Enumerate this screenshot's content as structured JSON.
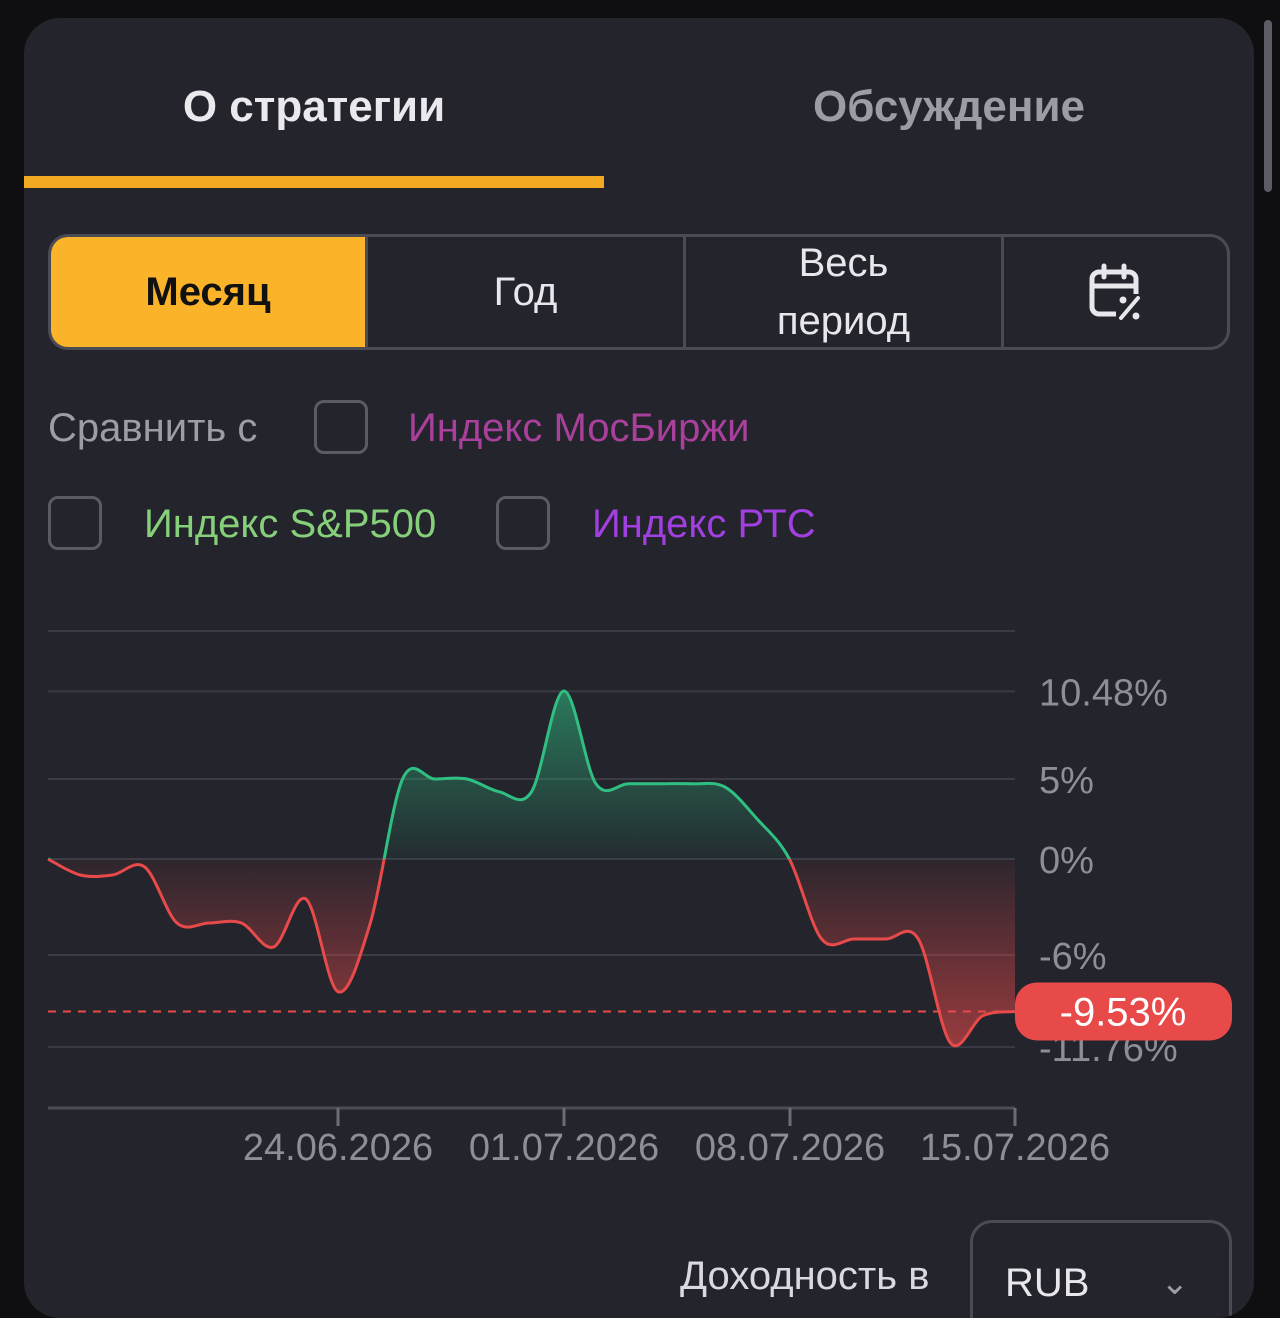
{
  "tabs": [
    {
      "label": "О стратегии",
      "active": true
    },
    {
      "label": "Обсуждение",
      "active": false
    }
  ],
  "period": {
    "options": [
      "Месяц",
      "Год",
      "Весь",
      "период"
    ],
    "selected": "Месяц",
    "calendar_icon": "calendar-percent-icon"
  },
  "compare": {
    "label": "Сравнить с",
    "indexes": [
      {
        "label": "Индекс МосБиржи",
        "color": "#a8409c",
        "checked": false
      },
      {
        "label": "Индекс S&P500",
        "color": "#86d07a",
        "checked": false
      },
      {
        "label": "Индекс РТС",
        "color": "#a23fe0",
        "checked": false
      }
    ]
  },
  "chart_data": {
    "type": "area",
    "y_tick_labels": [
      "10.48%",
      "5%",
      "0%",
      "-6%",
      "-11.76%"
    ],
    "y_ticks": [
      10.48,
      5,
      0,
      -6,
      -11.76
    ],
    "x_tick_labels": [
      "24.06.2026",
      "01.07.2026",
      "08.07.2026",
      "15.07.2026"
    ],
    "current_value_label": "-9.53%",
    "current_value": -9.53,
    "positive_color": "#2fbf82",
    "negative_color": "#e84a4a",
    "x_range": [
      "15.06.2026",
      "15.07.2026"
    ],
    "series": [
      {
        "x": [
          "15.06.2026",
          "16.06.2026",
          "17.06.2026",
          "18.06.2026",
          "19.06.2026",
          "20.06.2026",
          "21.06.2026",
          "22.06.2026",
          "23.06.2026",
          "24.06.2026",
          "25.06.2026",
          "26.06.2026",
          "27.06.2026",
          "28.06.2026",
          "29.06.2026",
          "30.06.2026",
          "01.07.2026",
          "02.07.2026",
          "03.07.2026",
          "04.07.2026",
          "05.07.2026",
          "06.07.2026",
          "07.07.2026",
          "08.07.2026",
          "09.07.2026",
          "10.07.2026",
          "11.07.2026",
          "12.07.2026",
          "13.07.2026",
          "14.07.2026",
          "15.07.2026"
        ],
        "values": [
          0,
          -1,
          -1,
          -0.5,
          -4,
          -4,
          -4,
          -5.5,
          -2.5,
          -8.3,
          -4,
          5,
          5,
          5,
          4.2,
          4.2,
          10.5,
          4.7,
          4.7,
          4.7,
          4.7,
          4.5,
          2.5,
          0,
          -5,
          -5,
          -5,
          -5,
          -11.5,
          -9.8,
          -9.53
        ]
      }
    ]
  },
  "returns": {
    "label": "Доходность в",
    "currency": "RUB"
  }
}
